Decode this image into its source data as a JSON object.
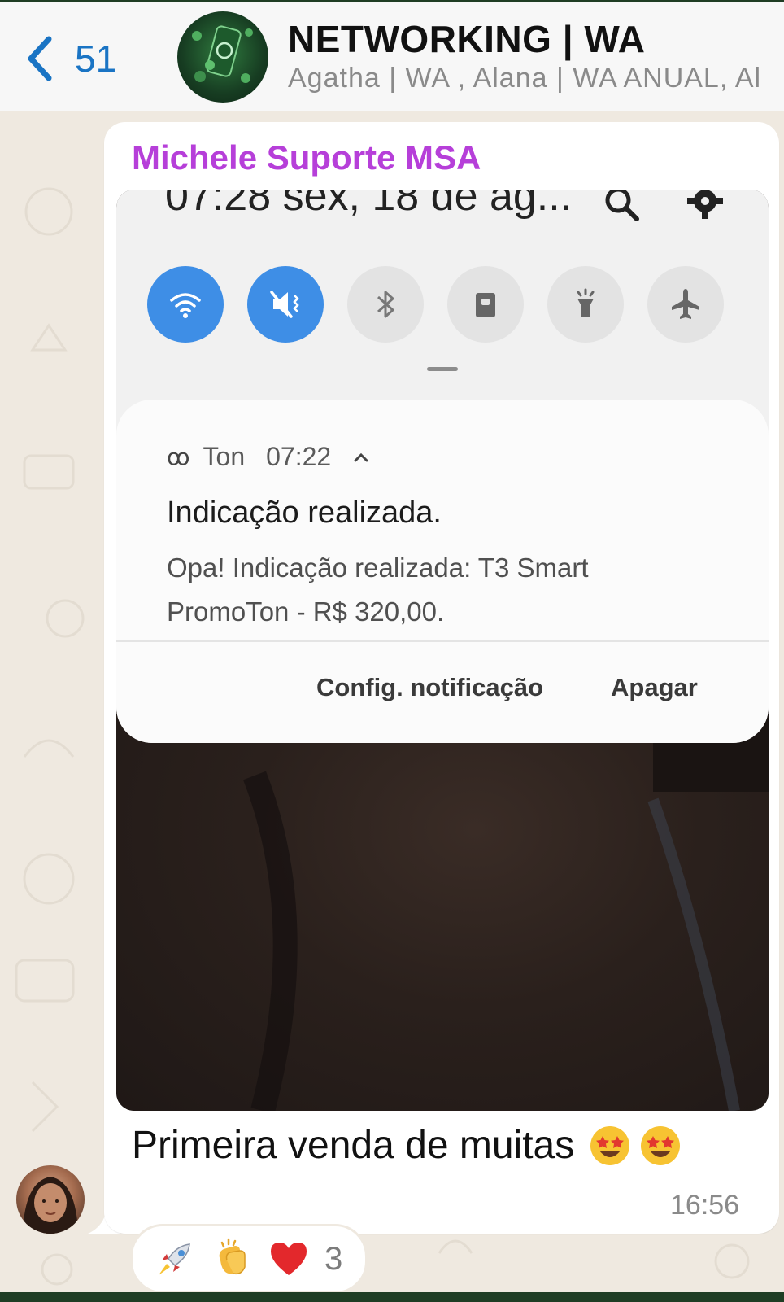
{
  "header": {
    "back_count": "51",
    "title": "NETWORKING | WA",
    "members": "Agatha | WA , Alana | WA ANUAL, Al"
  },
  "message": {
    "sender": "Michele Suporte MSA",
    "caption": "Primeira venda de muitas",
    "time": "16:56",
    "reactions": [
      "rocket-emoji",
      "clapping-hands-emoji",
      "red-heart-emoji"
    ],
    "reaction_count": "3",
    "screenshot": {
      "status": "07:28  sex, 18 de ag...",
      "quick_settings": [
        "wifi",
        "mute",
        "bluetooth",
        "portrait-lock",
        "flashlight",
        "airplane"
      ],
      "notification": {
        "app": "Ton",
        "time": "07:22",
        "title": "Indicação realizada.",
        "body": "Opa! Indicação realizada: T3 Smart PromoTon - R$ 320,00.",
        "action_settings": "Config. notificação",
        "action_clear": "Apagar"
      }
    }
  },
  "colors": {
    "accent": "#1a74c4",
    "sender_name": "#b63fd9",
    "qs_active": "#3e8ee6"
  }
}
